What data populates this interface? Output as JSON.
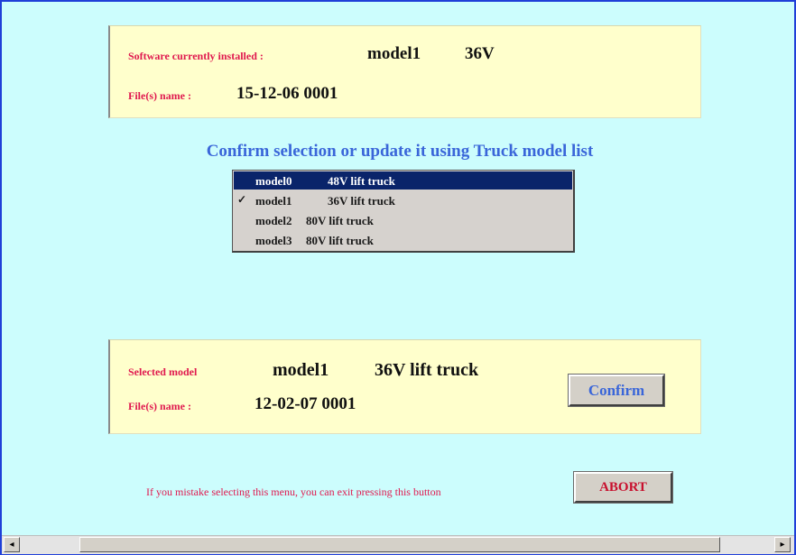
{
  "installed": {
    "label": "Software currently installed :",
    "model": "model1",
    "voltage": "36V",
    "file_label": "File(s) name :",
    "file_name": "15-12-06 0001"
  },
  "heading": "Confirm selection or update it using Truck model list",
  "model_list": {
    "items": [
      {
        "code": "model0",
        "desc": "48V lift truck",
        "check": ""
      },
      {
        "code": "model1",
        "desc": "36V lift truck",
        "check": "✓"
      },
      {
        "code": "model2",
        "desc": "80V lift truck",
        "check": ""
      },
      {
        "code": "model3",
        "desc": "80V lift truck",
        "check": ""
      }
    ],
    "highlighted_index": 0,
    "checked_index": 1
  },
  "selected": {
    "label": "Selected model",
    "model": "model1",
    "description": "36V lift truck",
    "file_label": "File(s) name :",
    "file_name": "12-02-07 0001",
    "confirm_label": "Confirm"
  },
  "abort": {
    "hint": "If you mistake selecting this menu, you can exit pressing this button",
    "button_label": "ABORT"
  },
  "scrollbar": {
    "left_arrow": "◂",
    "right_arrow": "▸"
  },
  "colors": {
    "background": "#ccfdfd",
    "panel": "#ffffcc",
    "label_red": "#e0194f",
    "heading_blue": "#3a66d9",
    "selection_navy": "#0a246a",
    "abort_text": "#c8102e",
    "confirm_text": "#3a66d9"
  }
}
